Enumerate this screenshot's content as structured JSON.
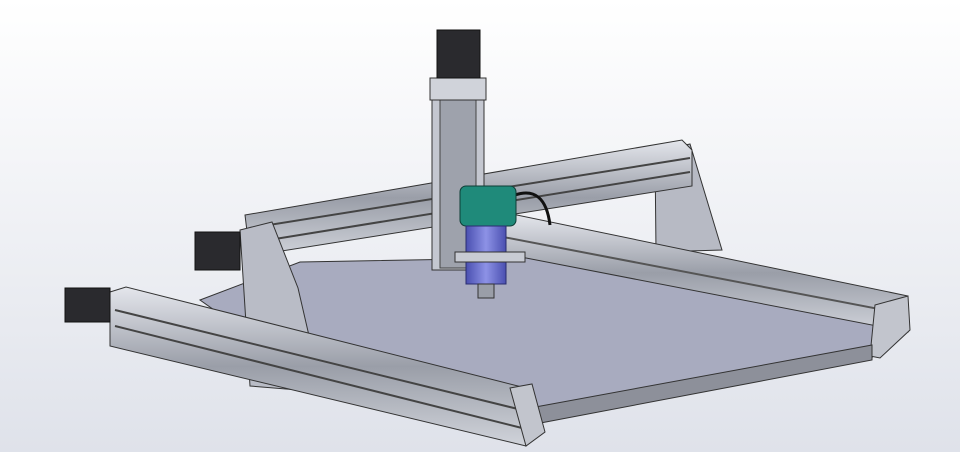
{
  "colors": {
    "background_top": "#ffffff",
    "background_bottom": "#dfe2ea",
    "bed": "#a8abbf",
    "rail": "#c9ccd4",
    "rail_dark": "#5c6068",
    "plate": "#b9bcc6",
    "motor": "#2a2a2e",
    "router_green": "#1f8a7a",
    "router_blue": "#6a6fd0"
  }
}
